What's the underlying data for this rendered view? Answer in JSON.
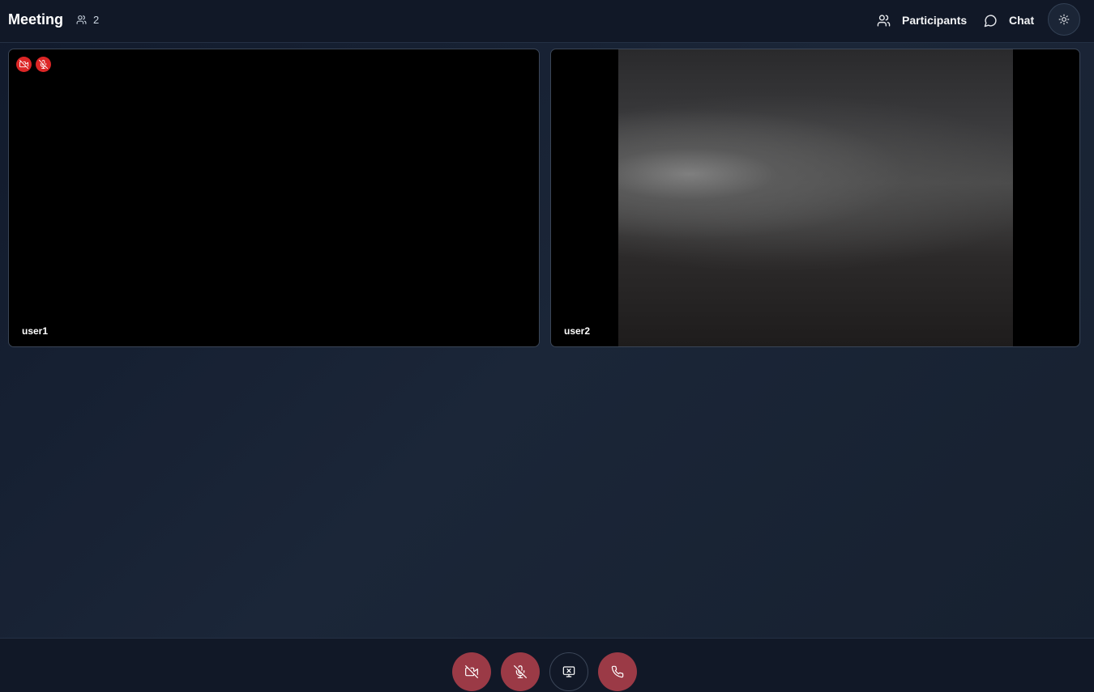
{
  "header": {
    "title": "Meeting",
    "participant_count": "2",
    "participants_label": "Participants",
    "chat_label": "Chat"
  },
  "tiles": [
    {
      "name": "user1",
      "camera": "off",
      "mic": "off"
    },
    {
      "name": "user2",
      "camera": "on",
      "mic": "on"
    }
  ],
  "controls": [
    {
      "icon": "video-off-icon",
      "state": "off"
    },
    {
      "icon": "mic-off-icon",
      "state": "off"
    },
    {
      "icon": "screen-share-off-icon",
      "state": "off"
    },
    {
      "icon": "phone-icon",
      "state": "leave"
    }
  ],
  "colors": {
    "danger": "#dc2626",
    "control_red": "#9b3a46",
    "header_bg": "#111827"
  }
}
